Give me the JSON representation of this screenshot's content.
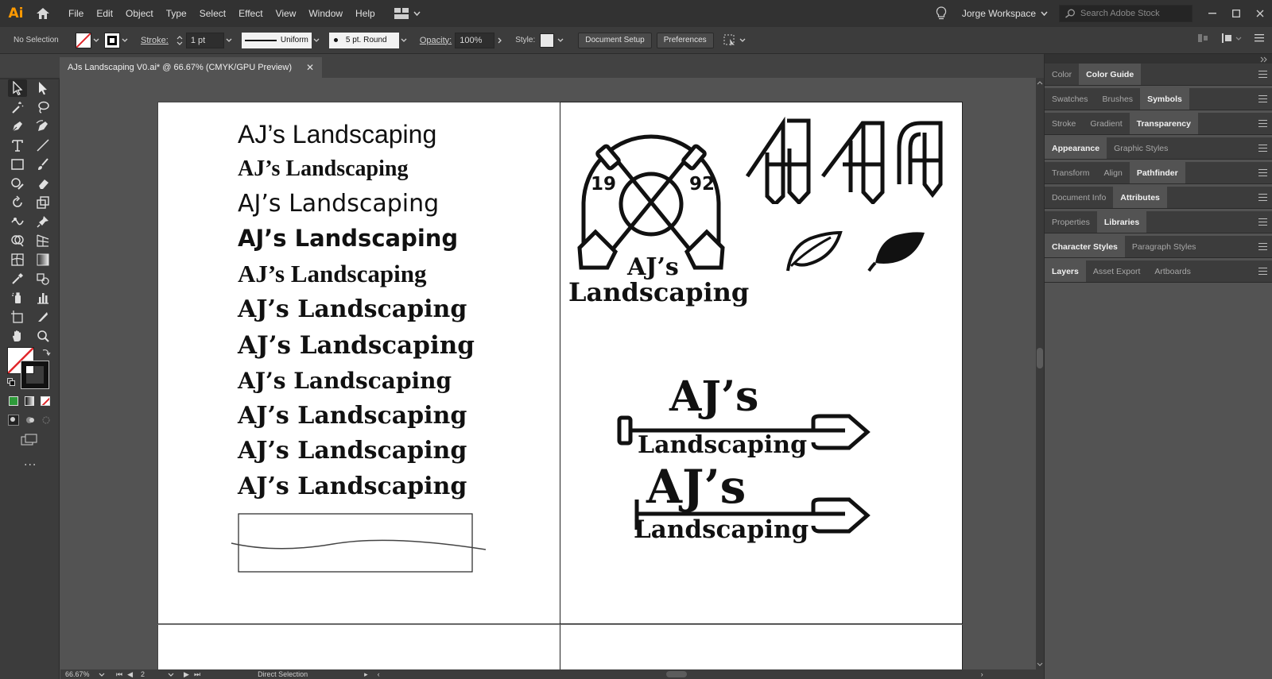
{
  "app": {
    "logo": "Ai"
  },
  "menu": {
    "items": [
      "File",
      "Edit",
      "Object",
      "Type",
      "Select",
      "Effect",
      "View",
      "Window",
      "Help"
    ]
  },
  "workspace": {
    "name": "Jorge Workspace"
  },
  "search": {
    "placeholder": "Search Adobe Stock"
  },
  "control_bar": {
    "selection": "No Selection",
    "stroke_label": "Stroke:",
    "stroke_weight": "1 pt",
    "profile": "Uniform",
    "brush": "5 pt. Round",
    "opacity_label": "Opacity:",
    "opacity": "100%",
    "style_label": "Style:",
    "document_setup": "Document Setup",
    "preferences": "Preferences"
  },
  "document": {
    "tab_title": "AJs Landscaping V0.ai* @ 66.67% (CMYK/GPU Preview)"
  },
  "status": {
    "zoom": "66.67%",
    "artboard_number": "2",
    "tool": "Direct Selection"
  },
  "panels": [
    {
      "tabs": [
        "Color",
        "Color Guide"
      ],
      "active": 1
    },
    {
      "tabs": [
        "Swatches",
        "Brushes",
        "Symbols"
      ],
      "active": 2
    },
    {
      "tabs": [
        "Stroke",
        "Gradient",
        "Transparency"
      ],
      "active": 2
    },
    {
      "tabs": [
        "Appearance",
        "Graphic Styles"
      ],
      "active": 0
    },
    {
      "tabs": [
        "Transform",
        "Align",
        "Pathfinder"
      ],
      "active": 2
    },
    {
      "tabs": [
        "Document Info",
        "Attributes"
      ],
      "active": 1
    },
    {
      "tabs": [
        "Properties",
        "Libraries"
      ],
      "active": 1
    },
    {
      "tabs": [
        "Character Styles",
        "Paragraph Styles"
      ],
      "active": 0
    },
    {
      "tabs": [
        "Layers",
        "Asset Export",
        "Artboards"
      ],
      "active": 0
    }
  ],
  "artwork": {
    "font_samples": [
      "AJ’s Landscaping",
      "AJ’s Landscaping",
      "AJ’s Landscaping",
      "AJ’s Landscaping",
      "AJ’s Landscaping",
      "AJ’s Landscaping",
      "AJ’s Landscaping",
      "AJ’s Landscaping",
      "AJ’s Landscaping",
      "AJ’s Landscaping",
      "AJ’s Landscaping"
    ],
    "emblem_year_left": "19",
    "emblem_year_right": "92",
    "logo_line1": "AJ’s",
    "logo_line2": "Landscaping"
  }
}
